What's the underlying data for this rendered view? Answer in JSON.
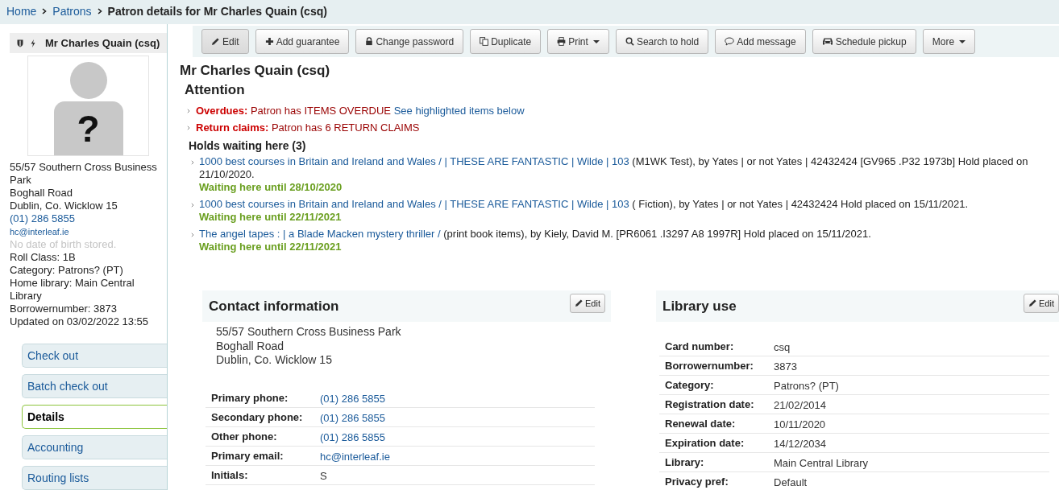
{
  "breadcrumbs": [
    {
      "label": "Home",
      "kind": "link"
    },
    {
      "label": "Patrons",
      "kind": "link"
    },
    {
      "label": "Patron details for Mr Charles Quain (csq)",
      "kind": "current"
    }
  ],
  "sidebar": {
    "patron_name": "Mr Charles Quain (csq)",
    "photo_mark": "?",
    "address_lines": [
      "55/57 Southern Cross Business Park",
      "Boghall Road",
      "Dublin, Co. Wicklow 15"
    ],
    "phone": "(01) 286 5855",
    "email": "hc@interleaf.ie",
    "dob_note": "No date of birth stored.",
    "details": [
      "Roll Class: 1B",
      "Category: Patrons? (PT)",
      "Home library: Main Central Library",
      "Borrowernumber: 3873",
      "Updated on 03/02/2022 13:55"
    ],
    "nav": [
      {
        "label": "Check out",
        "selected": false
      },
      {
        "label": "Batch check out",
        "selected": false
      },
      {
        "label": "Details",
        "selected": true
      },
      {
        "label": "Accounting",
        "selected": false
      },
      {
        "label": "Routing lists",
        "selected": false
      }
    ]
  },
  "toolbar": [
    {
      "label": "Edit",
      "kind": "pencil",
      "dropdown": false,
      "selected": true
    },
    {
      "label": "Add guarantee",
      "kind": "plus",
      "dropdown": false,
      "selected": false
    },
    {
      "label": "Change password",
      "kind": "lock",
      "dropdown": false,
      "selected": false
    },
    {
      "label": "Duplicate",
      "kind": "copy",
      "dropdown": false,
      "selected": false
    },
    {
      "label": "Print",
      "kind": "printer",
      "dropdown": true,
      "selected": false
    },
    {
      "label": "Search to hold",
      "kind": "search",
      "dropdown": false,
      "selected": false
    },
    {
      "label": "Add message",
      "kind": "speech",
      "dropdown": false,
      "selected": false
    },
    {
      "label": "Schedule pickup",
      "kind": "car",
      "dropdown": false,
      "selected": false
    },
    {
      "label": "More",
      "kind": "plain",
      "dropdown": true,
      "selected": false
    }
  ],
  "patron_title": "Mr Charles Quain (csq)",
  "attention": {
    "title": "Attention",
    "items": [
      {
        "label": "Overdues:",
        "text": "Patron has ITEMS OVERDUE",
        "link": "See highlighted items below"
      },
      {
        "label": "Return claims:",
        "text": "Patron has 6 RETURN CLAIMS"
      }
    ]
  },
  "holds": {
    "title": "Holds waiting here (3)",
    "items": [
      {
        "title": "1000 best courses in Britain and Ireland and Wales / | THESE ARE FANTASTIC | Wilde | 103",
        "details": "(M1WK Test), by Yates | or not Yates | 42432424 [GV965 .P32 1973b] Hold placed on 21/10/2020.",
        "waiting": "Waiting here until 28/10/2020"
      },
      {
        "title": "1000 best courses in Britain and Ireland and Wales / | THESE ARE FANTASTIC | Wilde | 103",
        "details": "( Fiction), by Yates | or not Yates | 42432424 Hold placed on 15/11/2021.",
        "waiting": "Waiting here until 22/11/2021"
      },
      {
        "title": "The angel tapes : | a Blade Macken mystery thriller /",
        "details": "(print book items), by Kiely, David M. [PR6061 .I3297 A8 1997R] Hold placed on 15/11/2021.",
        "waiting": "Waiting here until 22/11/2021"
      }
    ]
  },
  "contact": {
    "title": "Contact information",
    "edit": "Edit",
    "address_lines": [
      "55/57 Southern Cross Business Park",
      "Boghall Road",
      "Dublin, Co. Wicklow 15"
    ],
    "fields": [
      {
        "label": "Primary phone:",
        "value": "(01) 286 5855",
        "kind": "link"
      },
      {
        "label": "Secondary phone:",
        "value": "(01) 286 5855",
        "kind": "link"
      },
      {
        "label": "Other phone:",
        "value": "(01) 286 5855",
        "kind": "link"
      },
      {
        "label": "Primary email:",
        "value": "hc@interleaf.ie",
        "kind": "link"
      },
      {
        "label": "Initials:",
        "value": "S",
        "kind": "text"
      }
    ]
  },
  "library_use": {
    "title": "Library use",
    "edit": "Edit",
    "fields": [
      {
        "label": "Card number:",
        "value": "csq",
        "kind": "text"
      },
      {
        "label": "Borrowernumber:",
        "value": "3873",
        "kind": "text"
      },
      {
        "label": "Category:",
        "value": "Patrons? (PT)",
        "kind": "text"
      },
      {
        "label": "Registration date:",
        "value": "21/02/2014",
        "kind": "text"
      },
      {
        "label": "Renewal date:",
        "value": "10/11/2020",
        "kind": "text"
      },
      {
        "label": "Expiration date:",
        "value": "14/12/2034",
        "kind": "text"
      },
      {
        "label": "Library:",
        "value": "Main Central Library",
        "kind": "text"
      },
      {
        "label": "Privacy pref:",
        "value": "Default",
        "kind": "text"
      }
    ]
  }
}
